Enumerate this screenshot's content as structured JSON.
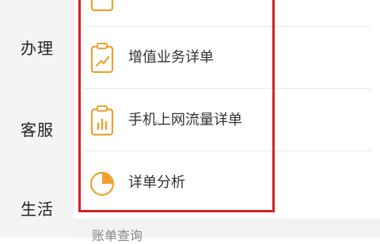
{
  "sidebar": {
    "items": [
      {
        "label": "办理"
      },
      {
        "label": "客服"
      },
      {
        "label": "生活"
      }
    ]
  },
  "list": {
    "items": [
      {
        "label": "",
        "icon": "document-icon"
      },
      {
        "label": "增值业务详单",
        "icon": "clipboard-trend-icon"
      },
      {
        "label": "手机上网流量详单",
        "icon": "clipboard-bars-icon"
      },
      {
        "label": "详单分析",
        "icon": "pie-chart-icon"
      }
    ]
  },
  "footer": {
    "section_title": "账单查询"
  },
  "colors": {
    "accent": "#f0a033",
    "highlight": "#d61f26"
  }
}
